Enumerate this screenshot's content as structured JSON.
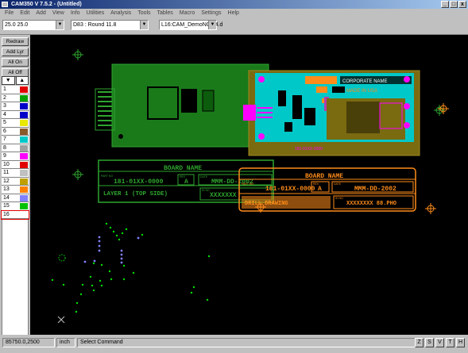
{
  "window": {
    "title": "CAM350 V 7.5.2 - (Untitled)",
    "minimize": "_",
    "maximize": "□",
    "close": "x"
  },
  "menu": [
    "File",
    "Edit",
    "Add",
    "View",
    "Info",
    "Utilities",
    "Analysis",
    "Tools",
    "Tables",
    "Macro",
    "Settings",
    "Help"
  ],
  "toolbar": {
    "grid": "25.0 25.0",
    "dcode": "D83 : Round 11.8",
    "layer": "L16:CAM_DemoNC3.4.d"
  },
  "side_buttons": [
    "Redraw",
    "Add Lyr",
    "All On",
    "All Off"
  ],
  "arrows": {
    "down": "▼",
    "up": "▲"
  },
  "layers": [
    {
      "num": "1",
      "color": "#e00000"
    },
    {
      "num": "2",
      "color": "#00a000"
    },
    {
      "num": "3",
      "color": "#0000c8"
    },
    {
      "num": "4",
      "color": "#0000c8"
    },
    {
      "num": "5",
      "color": "#e8e800"
    },
    {
      "num": "6",
      "color": "#8b5a2b"
    },
    {
      "num": "7",
      "color": "#00c8c8"
    },
    {
      "num": "8",
      "color": "#a0a0a0"
    },
    {
      "num": "9",
      "color": "#ff00ff"
    },
    {
      "num": "10",
      "color": "#e00000"
    },
    {
      "num": "11",
      "color": "#c0c0c0"
    },
    {
      "num": "12",
      "color": "#c0a000"
    },
    {
      "num": "13",
      "color": "#ff8000"
    },
    {
      "num": "14",
      "color": "#8080ff"
    },
    {
      "num": "15",
      "color": "#00c000"
    },
    {
      "num": "16",
      "color": "#ffffff"
    }
  ],
  "title_block_green": {
    "header": "BOARD NAME",
    "part_no_label": "PART NO",
    "part_no": "181-01XX-0000",
    "rev_label": "REV",
    "rev": "A",
    "date_label": "DATE",
    "date": "MMM-DD-2002",
    "layer": "LAYER 1 (TOP SIDE)",
    "id_label": "ID NO",
    "id": "XXXXXXX"
  },
  "title_block_orange": {
    "header": "BOARD NAME",
    "part_no_label": "PART NO",
    "part_no": "181-01XX-0000",
    "rev_label": "REV",
    "rev": "A",
    "date_label": "DATE",
    "date": "MMM-DD-2002",
    "drill_label": "DRILL DRAWING",
    "id_label": "ID NO",
    "id": "XXXXXXXX 88.PHO"
  },
  "board_text": {
    "cyan_top": "CORPORATE NAME",
    "cyan_mid": "MADE IN USA",
    "brown_bottom": "181-01XX-0000"
  },
  "status": {
    "coords": "85750.0,2500",
    "units": "inch",
    "command": "Select Command",
    "view_buttons": [
      "Z",
      "S",
      "V",
      "T",
      "H"
    ]
  }
}
